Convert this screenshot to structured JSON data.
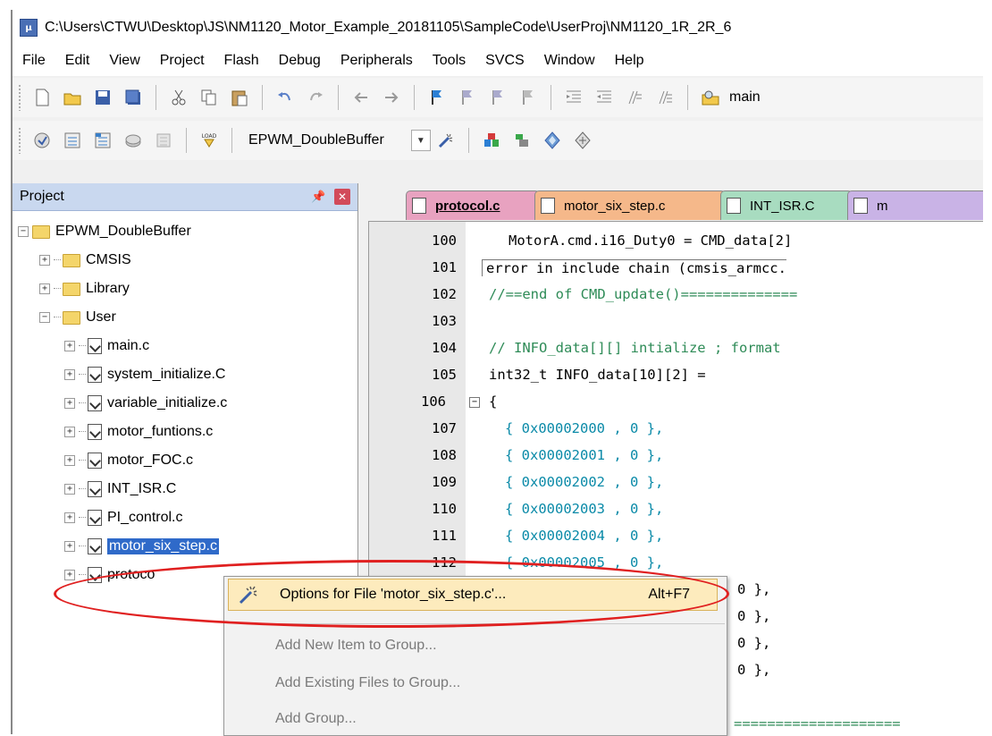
{
  "window": {
    "title": "C:\\Users\\CTWU\\Desktop\\JS\\NM1120_Motor_Example_20181105\\SampleCode\\UserProj\\NM1120_1R_2R_6"
  },
  "menu": [
    "File",
    "Edit",
    "View",
    "Project",
    "Flash",
    "Debug",
    "Peripherals",
    "Tools",
    "SVCS",
    "Window",
    "Help"
  ],
  "toolbar1": {
    "icons": [
      "new-file-icon",
      "open-folder-icon",
      "save-icon",
      "save-all-icon",
      "cut-icon",
      "copy-icon",
      "paste-icon",
      "undo-icon",
      "redo-icon",
      "back-icon",
      "forward-icon",
      "bookmark-icon",
      "prev-bookmark-icon",
      "next-bookmark-icon",
      "clear-bookmarks-icon",
      "indent-icon",
      "unindent-icon",
      "comment-icon",
      "uncomment-icon",
      "find-in-files-icon"
    ],
    "find_text": "main"
  },
  "toolbar2": {
    "load_label": "LOAD",
    "target_name": "EPWM_DoubleBuffer"
  },
  "project_panel": {
    "title": "Project",
    "tree": {
      "root": "EPWM_DoubleBuffer",
      "groups": [
        {
          "name": "CMSIS",
          "expanded": false
        },
        {
          "name": "Library",
          "expanded": false
        },
        {
          "name": "User",
          "expanded": true,
          "files": [
            "main.c",
            "system_initialize.C",
            "variable_initialize.c",
            "motor_funtions.c",
            "motor_FOC.c",
            "INT_ISR.C",
            "PI_control.c",
            "motor_six_step.c",
            "protocol.c"
          ]
        }
      ],
      "selected_file": "motor_six_step.c",
      "truncated_file": "protoco"
    }
  },
  "editor": {
    "tabs": [
      {
        "label": "protocol.c",
        "color": "#e8a2c0",
        "active": true
      },
      {
        "label": "motor_six_step.c",
        "color": "#f5b88a",
        "active": false
      },
      {
        "label": "INT_ISR.C",
        "color": "#a8dcc0",
        "active": false
      },
      {
        "label": "m",
        "color": "#c9b3e6",
        "active": false
      }
    ],
    "lines": [
      {
        "n": "100",
        "text": "MotorA.cmd.i16_Duty0 = CMD_data[2]"
      },
      {
        "n": "101",
        "text": "error in include chain (cmsis_armcc."
      },
      {
        "n": "102",
        "text": "//==end of CMD_update()=============="
      },
      {
        "n": "103",
        "text": ""
      },
      {
        "n": "104",
        "text": "// INFO_data[][] intialize ; format"
      },
      {
        "n": "105",
        "text": "int32_t INFO_data[10][2] ="
      },
      {
        "n": "106",
        "text": "{"
      },
      {
        "n": "107",
        "text": "{ 0x00002000 , 0 },"
      },
      {
        "n": "108",
        "text": "{ 0x00002001 , 0 },"
      },
      {
        "n": "109",
        "text": "{ 0x00002002 , 0 },"
      },
      {
        "n": "110",
        "text": "{ 0x00002003 , 0 },"
      },
      {
        "n": "111",
        "text": "{ 0x00002004 , 0 },"
      },
      {
        "n": "112",
        "text": "{ 0x00002005 , 0 },"
      }
    ],
    "partial_lines": [
      "0 },",
      "0 },",
      "0 },",
      "0 },"
    ],
    "bottom_line": "===================="
  },
  "context_menu": {
    "items": [
      {
        "label": "Options for File 'motor_six_step.c'...",
        "shortcut": "Alt+F7",
        "highlighted": true,
        "disabled": false
      },
      {
        "label": "Add New Item to Group...",
        "shortcut": "",
        "highlighted": false,
        "disabled": true
      },
      {
        "label": "Add Existing Files to Group...",
        "shortcut": "",
        "highlighted": false,
        "disabled": true
      },
      {
        "label": "Add Group...",
        "shortcut": "",
        "highlighted": false,
        "disabled": true
      }
    ]
  },
  "colors": {
    "annotation": "#e02020",
    "selection": "#2f6ac9",
    "menu_highlight": "#fdebbd"
  }
}
